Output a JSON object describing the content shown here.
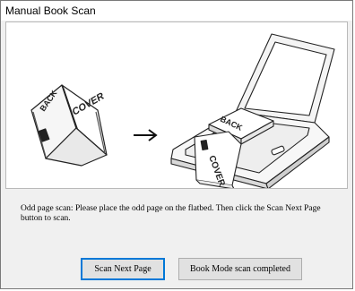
{
  "window": {
    "title": "Manual Book Scan"
  },
  "illustration": {
    "book_back_label": "BACK",
    "book_cover_label": "COVER",
    "scanner_back_label": "BACK",
    "scanner_cover_label": "COVER",
    "arrow_icon": "right-arrow-icon"
  },
  "instruction": {
    "text": "Odd page scan: Please place the odd page on the flatbed. Then click the Scan Next Page button to scan."
  },
  "buttons": {
    "scan_next_page": "Scan Next Page",
    "book_mode_completed": "Book Mode scan completed"
  }
}
